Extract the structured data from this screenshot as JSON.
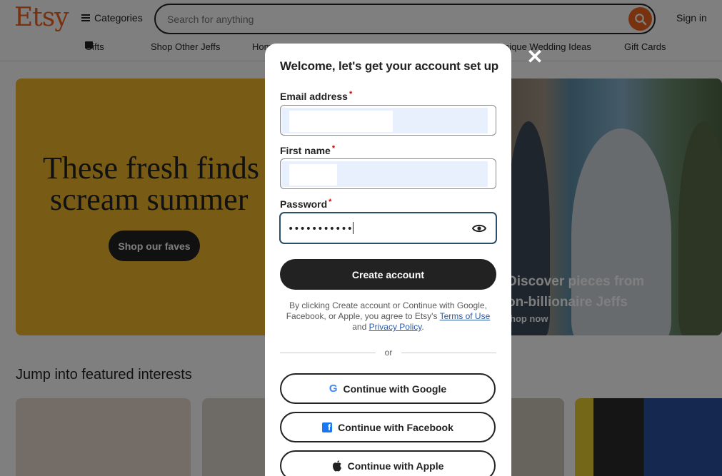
{
  "header": {
    "logo": "Etsy",
    "categories_label": "Categories",
    "search_placeholder": "Search for anything",
    "sign_in": "Sign in",
    "brand_color": "#f1641e"
  },
  "nav": {
    "items": [
      "Gifts",
      "Shop Other Jeffs",
      "Hom",
      "nique Wedding Ideas",
      "Gift Cards"
    ]
  },
  "hero_left": {
    "title_line1": "These fresh finds",
    "title_line2": "scream summer",
    "button": "Shop our faves",
    "background_color": "#f1b82a"
  },
  "hero_right": {
    "title_line1": "Discover pieces from",
    "title_line2": "on-billionaire Jeffs",
    "link": "hop now"
  },
  "featured": {
    "title": "Jump into featured interests"
  },
  "modal": {
    "title": "Welcome, let's get your account set up",
    "close_icon": "close-icon",
    "email_label": "Email address",
    "first_name_label": "First name",
    "password_label": "Password",
    "required_mark": "*",
    "password_value": "•••••••••••",
    "create_button": "Create account",
    "legal_text_1": "By clicking Create account or Continue with Google, Facebook, or Apple, you agree to Etsy's",
    "terms_link": "Terms of Use",
    "legal_and": "and",
    "privacy_link": "Privacy Policy",
    "legal_end": ".",
    "divider_text": "or",
    "google_button": "Continue with Google",
    "facebook_button": "Continue with Facebook",
    "apple_button": "Continue with Apple"
  }
}
